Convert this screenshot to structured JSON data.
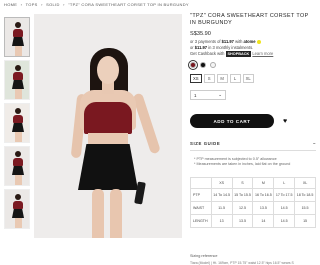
{
  "breadcrumb": [
    "HOME",
    "›",
    "TOPS",
    "›",
    "SOLID",
    "›",
    "\"TPZ\" CORA SWEETHEART CORSET TOP IN BURGUNDY"
  ],
  "product": {
    "title": "\"TPZ\" CORA SWEETHEART CORSET TOP IN BURGUNDY",
    "price": "S$35.90",
    "installment_atome_pre": "or 3 payments of",
    "installment_atome_amount": "$11.97",
    "installment_atome_post": "with",
    "atome_logo": "atome",
    "installment_shop_pre": "or",
    "installment_shop_amount": "$11.97",
    "installment_shop_mid": "in 3 monthly instalments.",
    "installment_shop_line2": "Get Cashback with",
    "shopback_logo": "SHOPBACK",
    "learn_more": "Learn more",
    "colors": [
      "#7a1820",
      "#111111",
      "#f4f4f4"
    ],
    "sizes": [
      "XS",
      "S",
      "M",
      "L",
      "XL"
    ],
    "selected_size": "XS",
    "quantity": "1",
    "add_to_cart": "ADD TO CART",
    "heart_icon": "♥"
  },
  "size_guide": {
    "title": "SIZE GUIDE",
    "toggle": "−",
    "notes": [
      "* PTP measurement is subjected to 0.5\" allowance",
      "* Measurements are taken in inches, laid flat on the ground"
    ],
    "headers": [
      "",
      "XS",
      "S",
      "M",
      "L",
      "XL"
    ],
    "rows": [
      [
        "PTP",
        "14 To 14.5",
        "15 To 15.5",
        "16 To 16.5",
        "17 To 17.5",
        "18 To 18.5"
      ],
      [
        "WAIST",
        "11.5",
        "12.5",
        "13.5",
        "14.5",
        "15.5"
      ],
      [
        "LENGTH",
        "13",
        "13.5",
        "14",
        "14.5",
        "15"
      ]
    ]
  },
  "fitting": {
    "label": "Sizing reference",
    "text": "Tiara (Model) | Ht. 169cm, PTP 15.75\" waist 12.5\" hips 16.5\" wears S"
  }
}
